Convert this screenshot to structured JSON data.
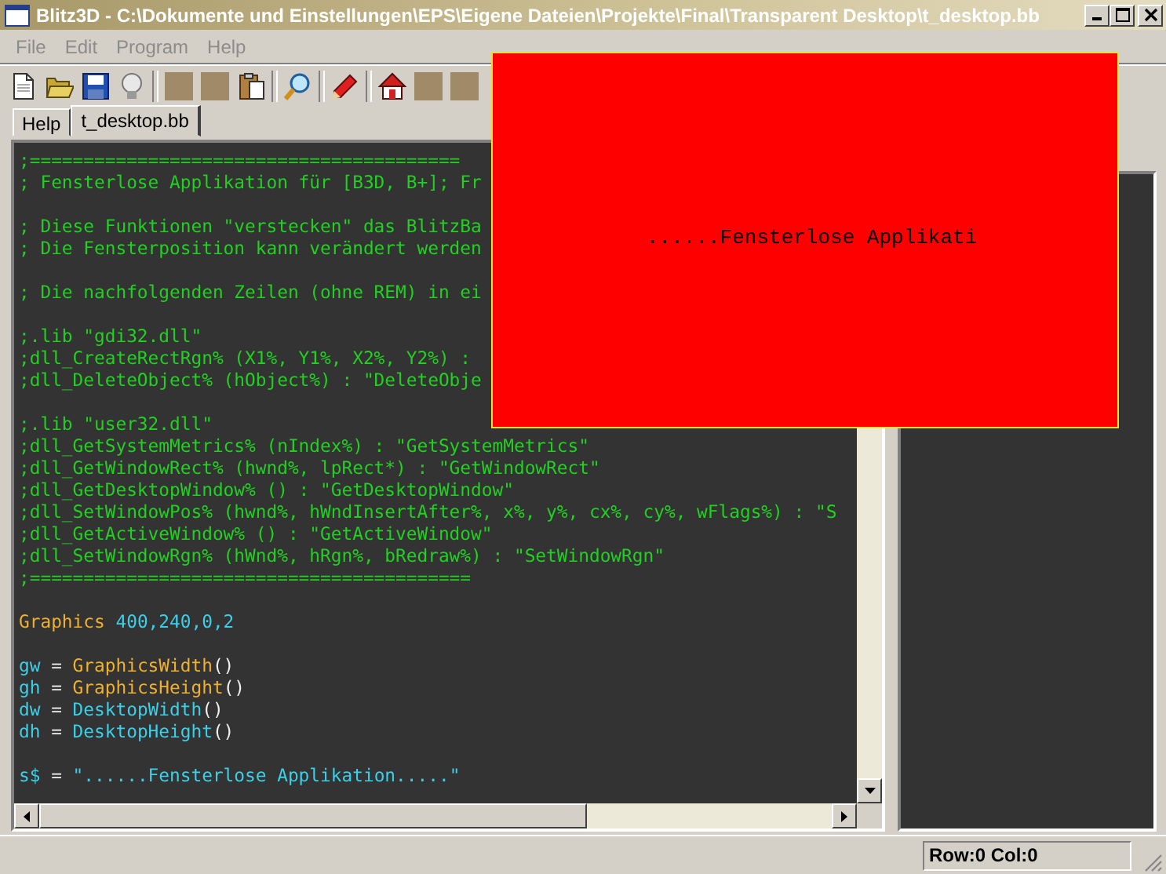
{
  "window": {
    "title": "Blitz3D - C:\\Dokumente und Einstellungen\\EPS\\Eigene Dateien\\Projekte\\Final\\Transparent Desktop\\t_desktop.bb"
  },
  "menu": [
    {
      "label": "File",
      "disabled": true
    },
    {
      "label": "Edit",
      "disabled": true
    },
    {
      "label": "Program",
      "disabled": true
    },
    {
      "label": "Help",
      "disabled": true
    }
  ],
  "tabs": [
    {
      "label": "Help",
      "selected": false
    },
    {
      "label": "t_desktop.bb",
      "selected": true
    }
  ],
  "editor": {
    "lines": [
      {
        "kind": "code",
        "segments": [
          {
            "kind": "comment",
            "text": ";========================================"
          }
        ]
      },
      {
        "kind": "code",
        "segments": [
          {
            "kind": "comment",
            "text": "; Fensterlose Applikation für [B3D, B+]; Fr"
          }
        ]
      },
      {
        "kind": "blank"
      },
      {
        "kind": "code",
        "segments": [
          {
            "kind": "comment",
            "text": "; Diese Funktionen \"verstecken\" das BlitzBa"
          }
        ]
      },
      {
        "kind": "code",
        "segments": [
          {
            "kind": "comment",
            "text": "; Die Fensterposition kann verändert werden"
          }
        ]
      },
      {
        "kind": "blank"
      },
      {
        "kind": "code",
        "segments": [
          {
            "kind": "comment",
            "text": "; Die nachfolgenden Zeilen (ohne REM) in ei"
          }
        ]
      },
      {
        "kind": "blank"
      },
      {
        "kind": "code",
        "segments": [
          {
            "kind": "comment",
            "text": ";.lib \"gdi32.dll\""
          }
        ]
      },
      {
        "kind": "code",
        "segments": [
          {
            "kind": "comment",
            "text": ";dll_CreateRectRgn% (X1%, Y1%, X2%, Y2%) :"
          }
        ]
      },
      {
        "kind": "code",
        "segments": [
          {
            "kind": "comment",
            "text": ";dll_DeleteObject% (hObject%) : \"DeleteObje"
          }
        ]
      },
      {
        "kind": "blank"
      },
      {
        "kind": "code",
        "segments": [
          {
            "kind": "comment",
            "text": ";.lib \"user32.dll\""
          }
        ]
      },
      {
        "kind": "code",
        "segments": [
          {
            "kind": "comment",
            "text": ";dll_GetSystemMetrics% (nIndex%) : \"GetSystemMetrics\""
          }
        ]
      },
      {
        "kind": "code",
        "segments": [
          {
            "kind": "comment",
            "text": ";dll_GetWindowRect% (hwnd%, lpRect*) : \"GetWindowRect\""
          }
        ]
      },
      {
        "kind": "code",
        "segments": [
          {
            "kind": "comment",
            "text": ";dll_GetDesktopWindow% () : \"GetDesktopWindow\""
          }
        ]
      },
      {
        "kind": "code",
        "segments": [
          {
            "kind": "comment",
            "text": ";dll_SetWindowPos% (hwnd%, hWndInsertAfter%, x%, y%, cx%, cy%, wFlags%) : \"S"
          }
        ]
      },
      {
        "kind": "code",
        "segments": [
          {
            "kind": "comment",
            "text": ";dll_GetActiveWindow% () : \"GetActiveWindow\""
          }
        ]
      },
      {
        "kind": "code",
        "segments": [
          {
            "kind": "comment",
            "text": ";dll_SetWindowRgn% (hWnd%, hRgn%, bRedraw%) : \"SetWindowRgn\""
          }
        ]
      },
      {
        "kind": "code",
        "segments": [
          {
            "kind": "comment",
            "text": ";========================================="
          }
        ]
      },
      {
        "kind": "blank"
      },
      {
        "kind": "code",
        "segments": [
          {
            "kind": "keyword",
            "text": "Graphics"
          },
          {
            "kind": "number",
            "text": " 400,240,0,2"
          }
        ]
      },
      {
        "kind": "blank"
      },
      {
        "kind": "code",
        "segments": [
          {
            "kind": "ident",
            "text": "gw"
          },
          {
            "kind": "op",
            "text": " = "
          },
          {
            "kind": "keyword",
            "text": "GraphicsWidth"
          },
          {
            "kind": "op",
            "text": "()"
          }
        ]
      },
      {
        "kind": "code",
        "segments": [
          {
            "kind": "ident",
            "text": "gh"
          },
          {
            "kind": "op",
            "text": " = "
          },
          {
            "kind": "keyword",
            "text": "GraphicsHeight"
          },
          {
            "kind": "op",
            "text": "()"
          }
        ]
      },
      {
        "kind": "code",
        "segments": [
          {
            "kind": "ident",
            "text": "dw"
          },
          {
            "kind": "op",
            "text": " = "
          },
          {
            "kind": "ident",
            "text": "DesktopWidth"
          },
          {
            "kind": "op",
            "text": "()"
          }
        ]
      },
      {
        "kind": "code",
        "segments": [
          {
            "kind": "ident",
            "text": "dh"
          },
          {
            "kind": "op",
            "text": " = "
          },
          {
            "kind": "ident",
            "text": "DesktopHeight"
          },
          {
            "kind": "op",
            "text": "()"
          }
        ]
      },
      {
        "kind": "blank"
      },
      {
        "kind": "code",
        "segments": [
          {
            "kind": "ident",
            "text": "s$"
          },
          {
            "kind": "op",
            "text": " = "
          },
          {
            "kind": "string",
            "text": "\"......Fensterlose Applikation.....\""
          }
        ]
      }
    ]
  },
  "overlay_window": {
    "text": "......Fensterlose Applikati"
  },
  "status_bar": {
    "position": "Row:0 Col:0"
  }
}
